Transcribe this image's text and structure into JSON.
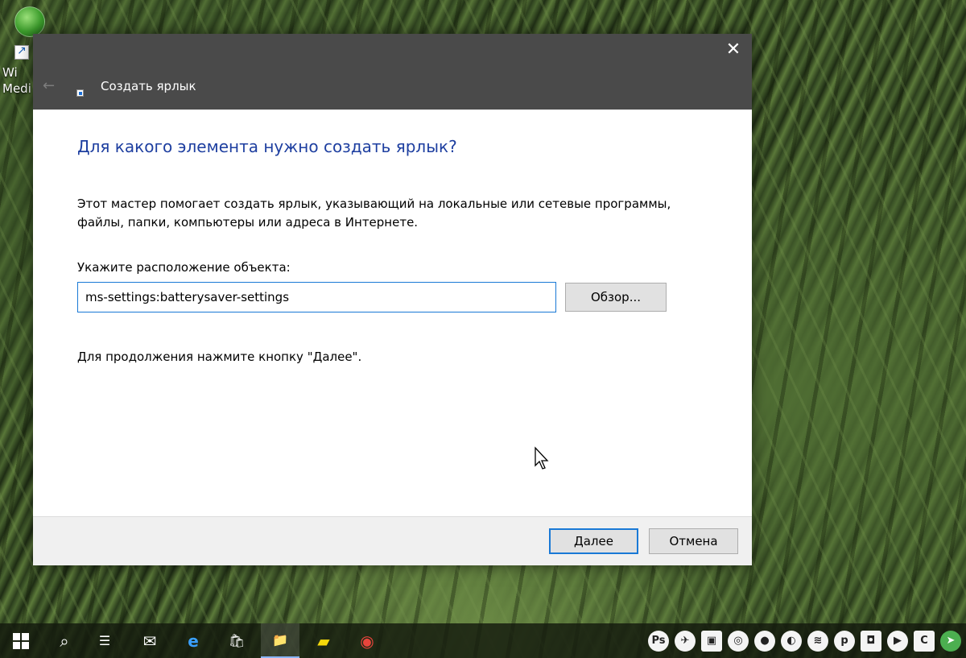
{
  "desktop": {
    "icon_label": "Wi\nMedi"
  },
  "dialog": {
    "title": "Создать ярлык",
    "close_glyph": "✕",
    "back_glyph": "←",
    "heading": "Для какого элемента нужно создать ярлык?",
    "description": "Этот мастер помогает создать ярлык, указывающий на локальные или сетевые программы, файлы, папки, компьютеры или адреса в Интернете.",
    "field_label": "Укажите расположение объекта:",
    "location_value": "ms-settings:batterysaver-settings",
    "browse_label": "Обзор...",
    "hint": "Для продолжения нажмите кнопку \"Далее\".",
    "next_label": "Далее",
    "cancel_label": "Отмена",
    "colors": {
      "heading": "#1e3fa0",
      "accent": "#1979d6",
      "titlebar": "#4a4a4a"
    }
  },
  "taskbar": {
    "pinned": [
      {
        "name": "start",
        "icon": "windows-logo-icon"
      },
      {
        "name": "search",
        "icon": "search-icon",
        "glyph": "⌕"
      },
      {
        "name": "task-view",
        "icon": "task-view-icon",
        "glyph": "☰"
      },
      {
        "name": "mail",
        "icon": "mail-icon",
        "glyph": "✉"
      },
      {
        "name": "edge",
        "icon": "edge-icon",
        "glyph": "e"
      },
      {
        "name": "store",
        "icon": "store-icon",
        "glyph": "🛍"
      },
      {
        "name": "file-explorer",
        "icon": "folder-icon",
        "glyph": "📁"
      },
      {
        "name": "sticky-notes",
        "icon": "sticky-notes-icon",
        "glyph": "▰"
      },
      {
        "name": "chrome",
        "icon": "chrome-icon",
        "glyph": "◉"
      }
    ],
    "tray": [
      {
        "icon": "photoshop-icon",
        "glyph": "Ps"
      },
      {
        "icon": "feather-icon",
        "glyph": "✈"
      },
      {
        "icon": "image-icon",
        "glyph": "▣"
      },
      {
        "icon": "chrome-tray-icon",
        "glyph": "◎"
      },
      {
        "icon": "firefox-icon",
        "glyph": "●"
      },
      {
        "icon": "eye-icon",
        "glyph": "◐"
      },
      {
        "icon": "layers-icon",
        "glyph": "≋"
      },
      {
        "icon": "p-icon",
        "glyph": "p"
      },
      {
        "icon": "record-icon",
        "glyph": "◘"
      },
      {
        "icon": "play-icon",
        "glyph": "▶"
      },
      {
        "icon": "c-icon",
        "glyph": "C"
      },
      {
        "icon": "telegram-icon",
        "glyph": "➤"
      }
    ]
  }
}
